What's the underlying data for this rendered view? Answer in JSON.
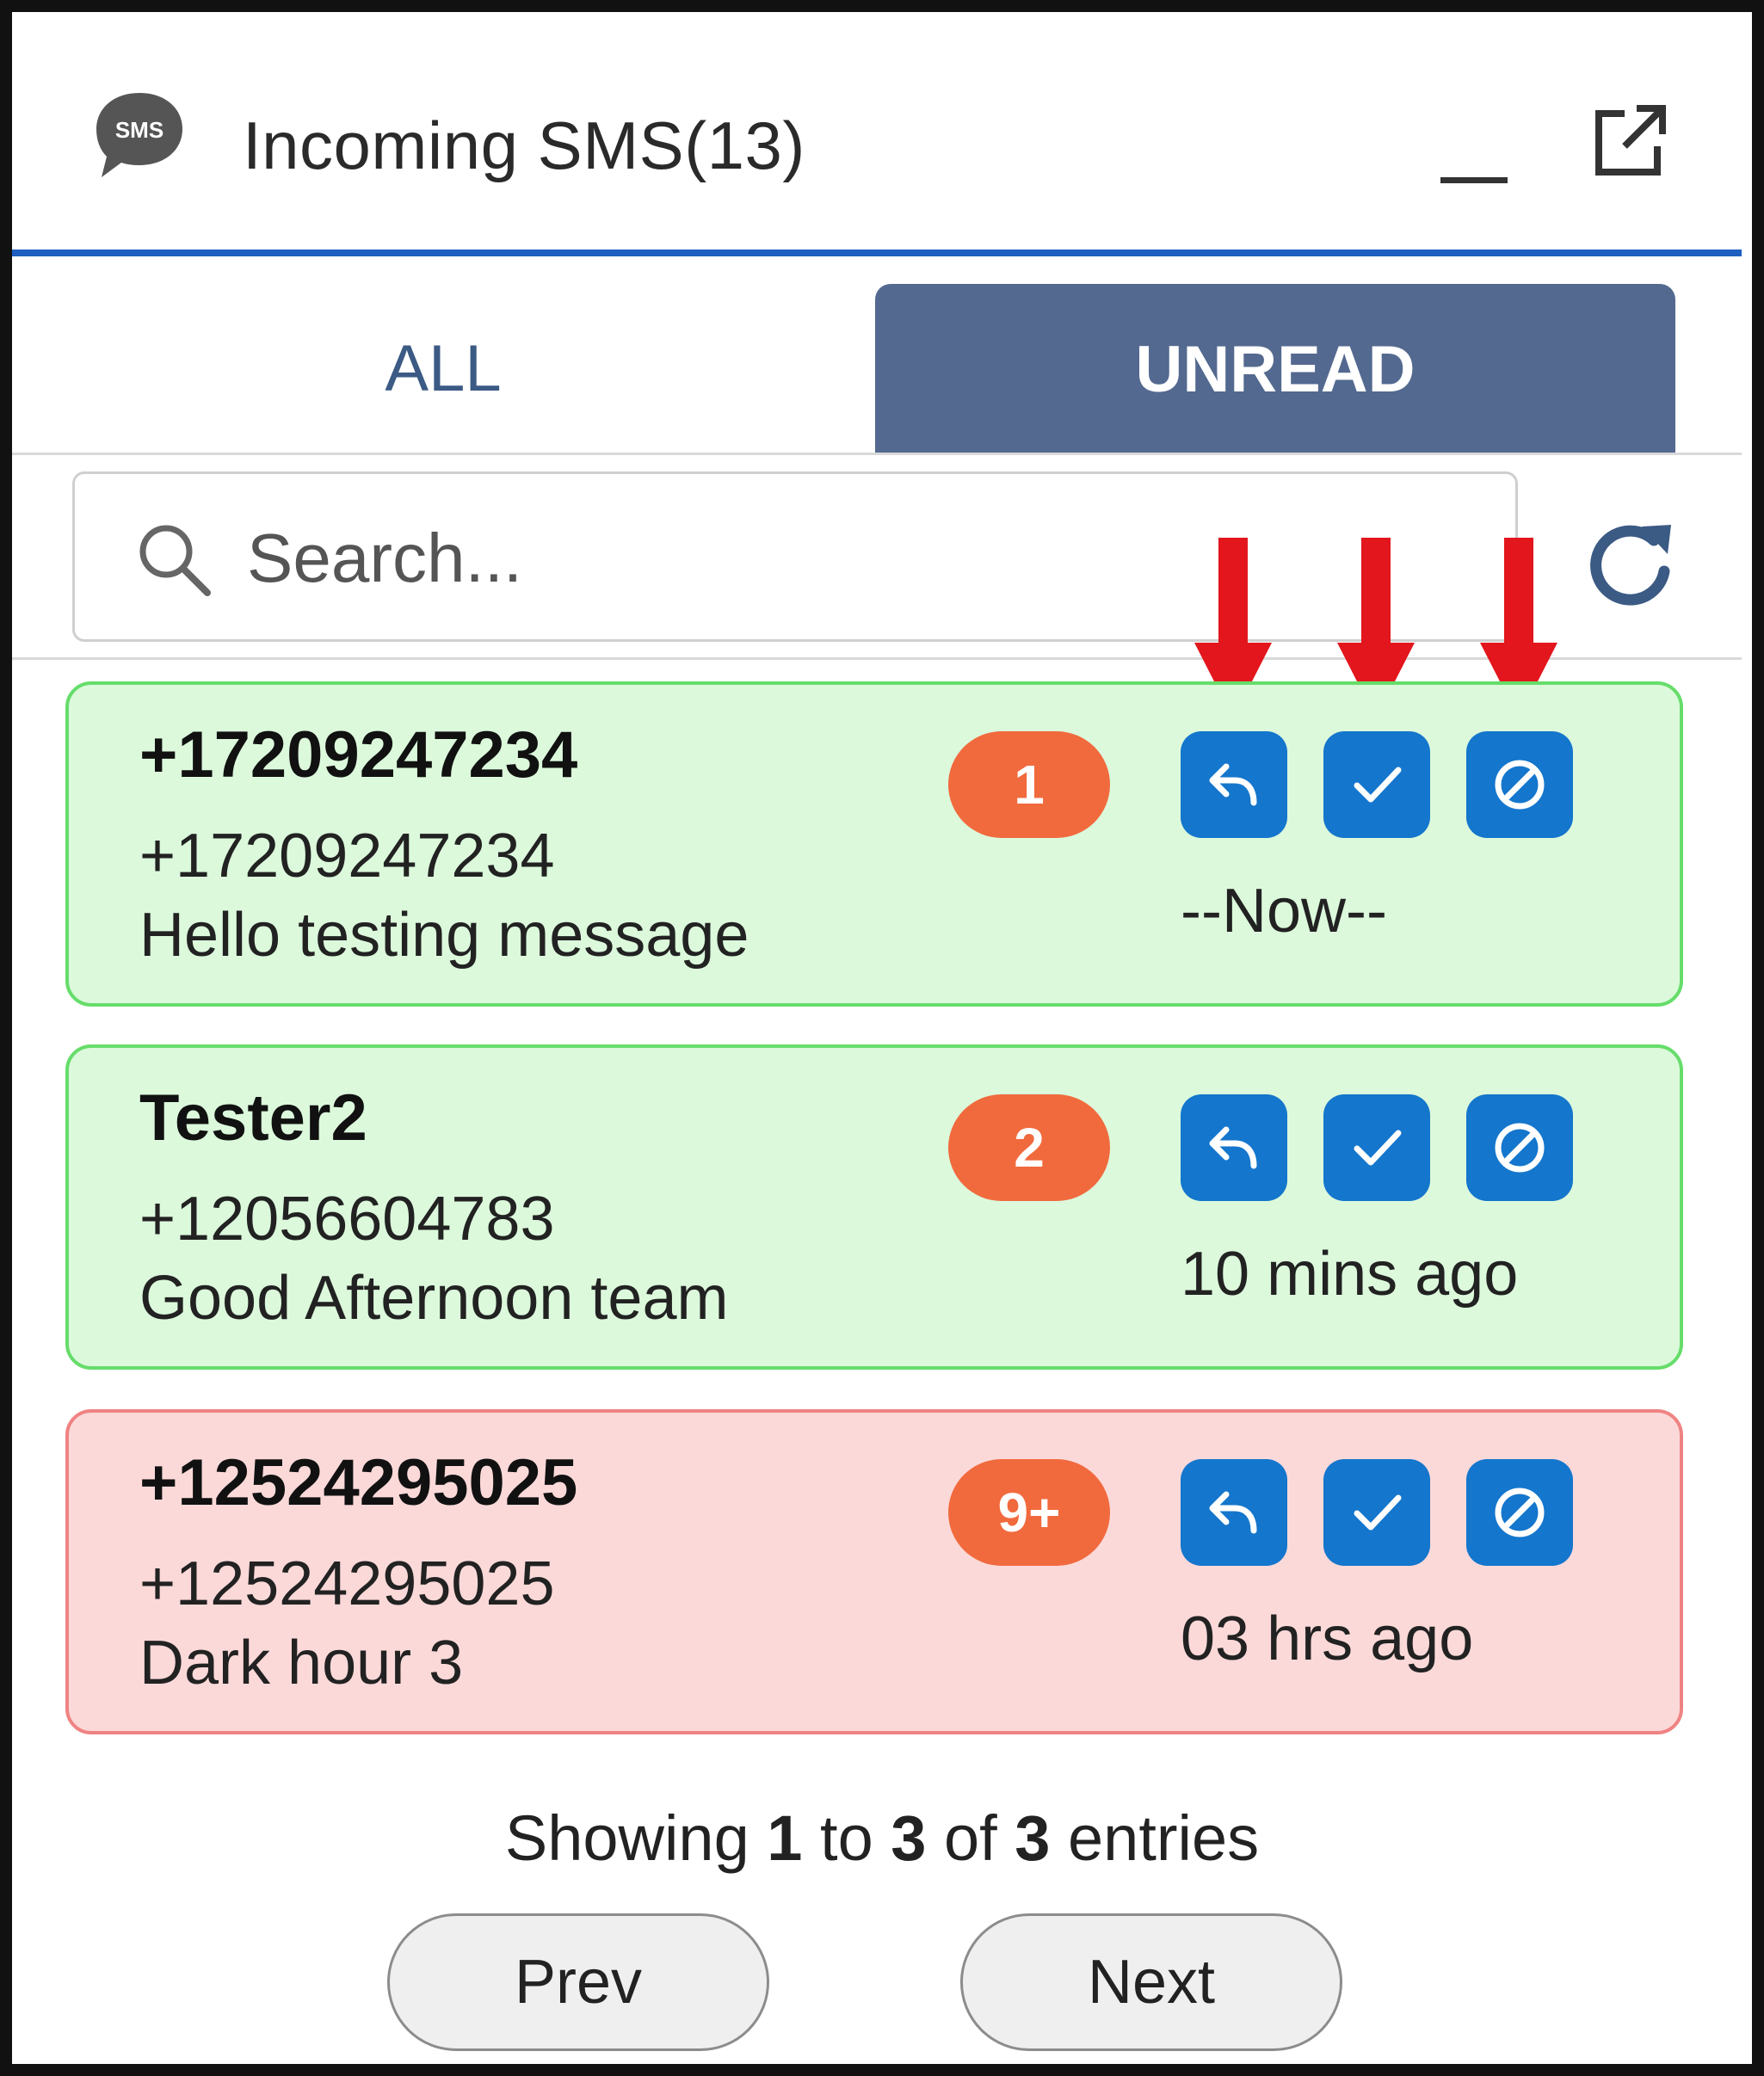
{
  "header": {
    "icon_text": "SMS",
    "title": "Incoming SMS(13)",
    "minimize_icon": "minimize-icon",
    "popout_icon": "external-link-icon"
  },
  "tabs": [
    {
      "label": "ALL",
      "active": false
    },
    {
      "label": "UNREAD",
      "active": true
    }
  ],
  "search": {
    "placeholder": "Search...",
    "value": "",
    "icon": "search-icon",
    "refresh_icon": "refresh-icon"
  },
  "annotation": {
    "arrow_color": "#e3161d",
    "arrow_count": 3
  },
  "messages": [
    {
      "name": "+17209247234",
      "number": "+17209247234",
      "text": "Hello testing message",
      "count": "1",
      "time": "--Now--",
      "status": "green"
    },
    {
      "name": "Tester2",
      "number": "+12056604783",
      "text": "Good Afternoon team",
      "count": "2",
      "time": "10 mins ago",
      "status": "green"
    },
    {
      "name": "+12524295025",
      "number": "+12524295025",
      "text": "Dark hour 3",
      "count": "9+",
      "time": "03 hrs ago",
      "status": "red"
    }
  ],
  "actions": {
    "reply_icon": "reply-icon",
    "done_icon": "check-icon",
    "block_icon": "block-icon"
  },
  "pagination": {
    "showing_prefix": "Showing",
    "from": "1",
    "to_word": "to",
    "to": "3",
    "of_word": "of",
    "total": "3",
    "entries_word": "entries",
    "prev_label": "Prev",
    "next_label": "Next"
  },
  "colors": {
    "accent": "#1f5fbf",
    "tab_active": "#53698f",
    "button_blue": "#1476cc",
    "badge_orange": "#f16a3d",
    "card_green_bg": "#dcf9dc",
    "card_green_border": "#66dd6a",
    "card_red_bg": "#fcd9d9",
    "card_red_border": "#ef8383"
  }
}
